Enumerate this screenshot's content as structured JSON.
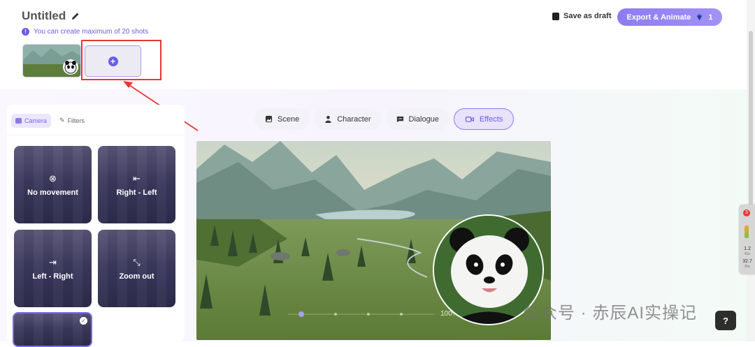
{
  "header": {
    "title": "Untitled",
    "info_text": "You can create maximum of 20 shots",
    "info_icon": "!",
    "save_draft_label": "Save as draft",
    "export_label": "Export & Animate",
    "export_count": "1"
  },
  "shots": {
    "add_symbol": "+"
  },
  "side_panel": {
    "tabs": [
      {
        "label": "Camera",
        "active": true
      },
      {
        "label": "Filters",
        "active": false
      }
    ],
    "cards": [
      {
        "label": "No movement",
        "icon": "⊗"
      },
      {
        "label": "Right - Left",
        "icon": "⇤"
      },
      {
        "label": "Left - Right",
        "icon": "⇥"
      },
      {
        "label": "Zoom out",
        "icon": "⤡"
      },
      {
        "label": "",
        "icon": "",
        "selected": true
      }
    ]
  },
  "editor_tabs": [
    {
      "label": "Scene",
      "icon": "image-icon"
    },
    {
      "label": "Character",
      "icon": "person-icon"
    },
    {
      "label": "Dialogue",
      "icon": "chat-icon"
    },
    {
      "label": "Effects",
      "icon": "camera-icon",
      "active": true
    }
  ],
  "player": {
    "zoom_text": "100%"
  },
  "watermark": "公众号 · 赤辰AI实操记",
  "help_label": "?",
  "float_widget": {
    "badge": "3",
    "stat1": "1.2",
    "stat1_unit": "K/s",
    "stat2": "32.7",
    "stat2_unit": "K/s"
  },
  "colors": {
    "accent": "#6b5ce7",
    "annotation": "#e53935"
  }
}
